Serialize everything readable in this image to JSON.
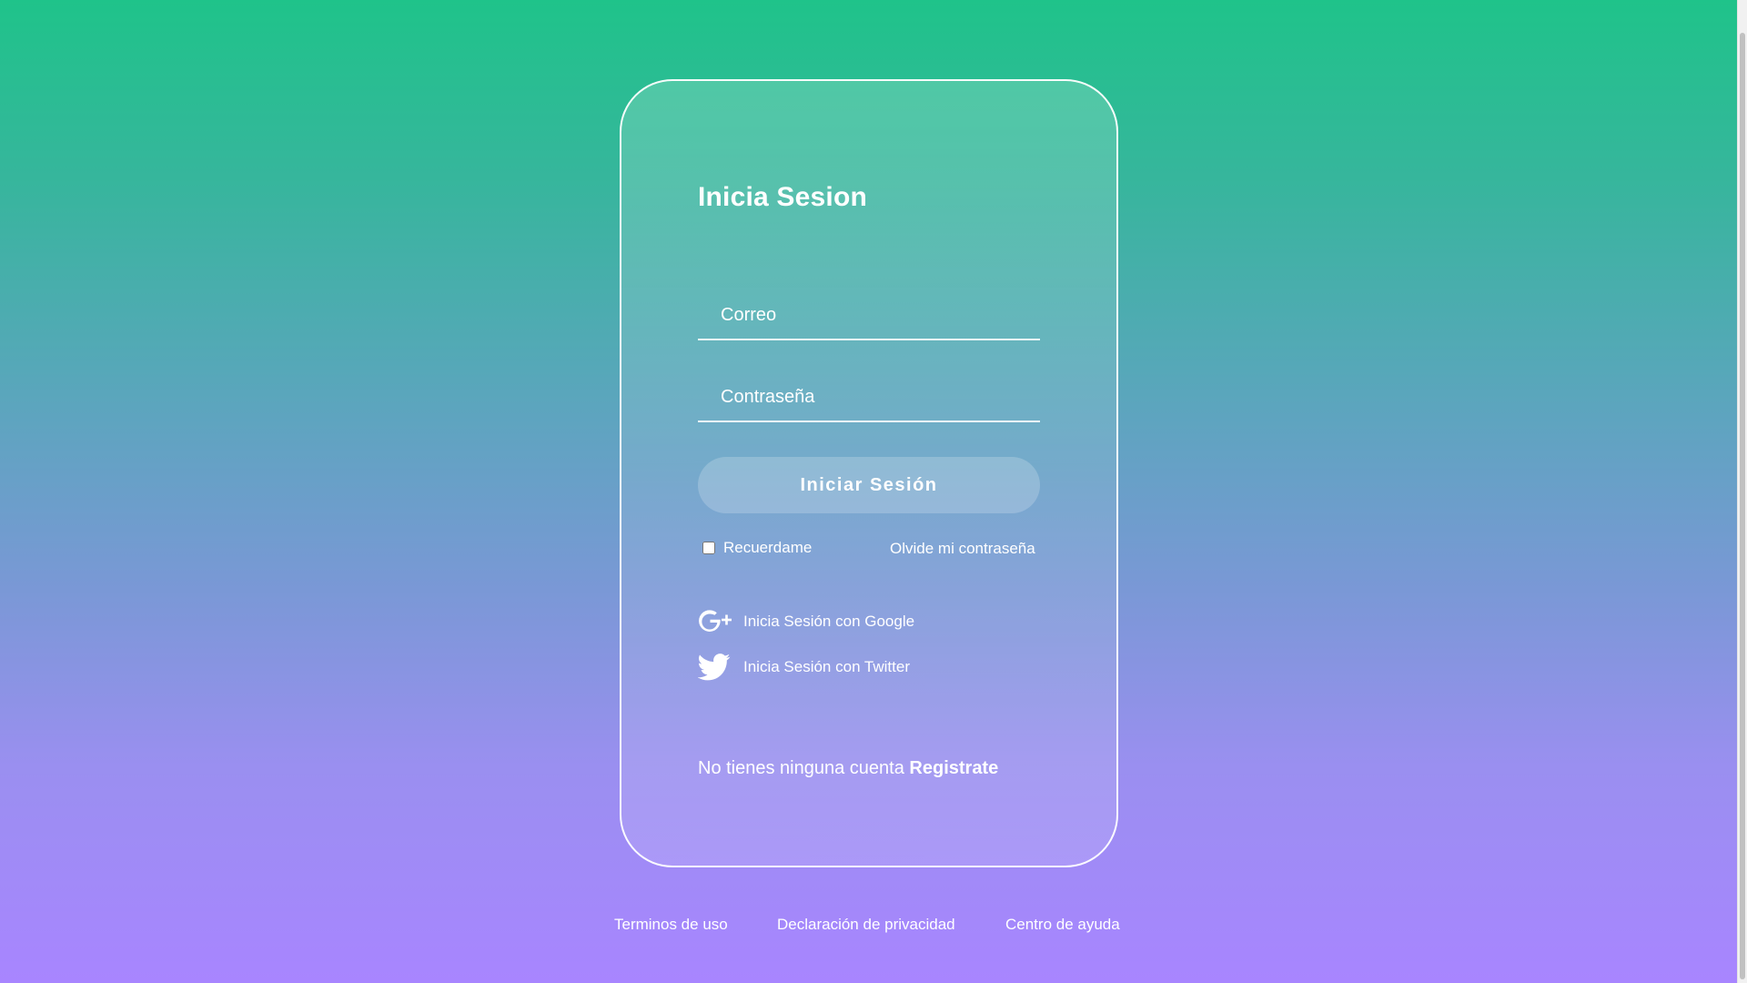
{
  "login": {
    "title": "Inicia Sesion",
    "email_placeholder": "Correo",
    "password_placeholder": "Contraseña",
    "submit_label": "Iniciar Sesión",
    "remember_label": "Recuerdame",
    "remember_checked": false,
    "forgot_label": "Olvide mi contraseña",
    "google_label": "Inicia Sesión con Google",
    "twitter_label": "Inicia Sesión con Twitter",
    "signup_prompt": "No tienes ninguna cuenta",
    "signup_link": "Registrate"
  },
  "footer": {
    "terms": "Terminos de uso",
    "privacy": "Declaración de privacidad",
    "help": "Centro de ayuda"
  },
  "colors": {
    "gradient_top": "#1fc38a",
    "gradient_bottom": "#a885ff",
    "text": "#ffffff"
  },
  "icons": {
    "google": "google-plus-icon",
    "twitter": "twitter-bird-icon"
  }
}
